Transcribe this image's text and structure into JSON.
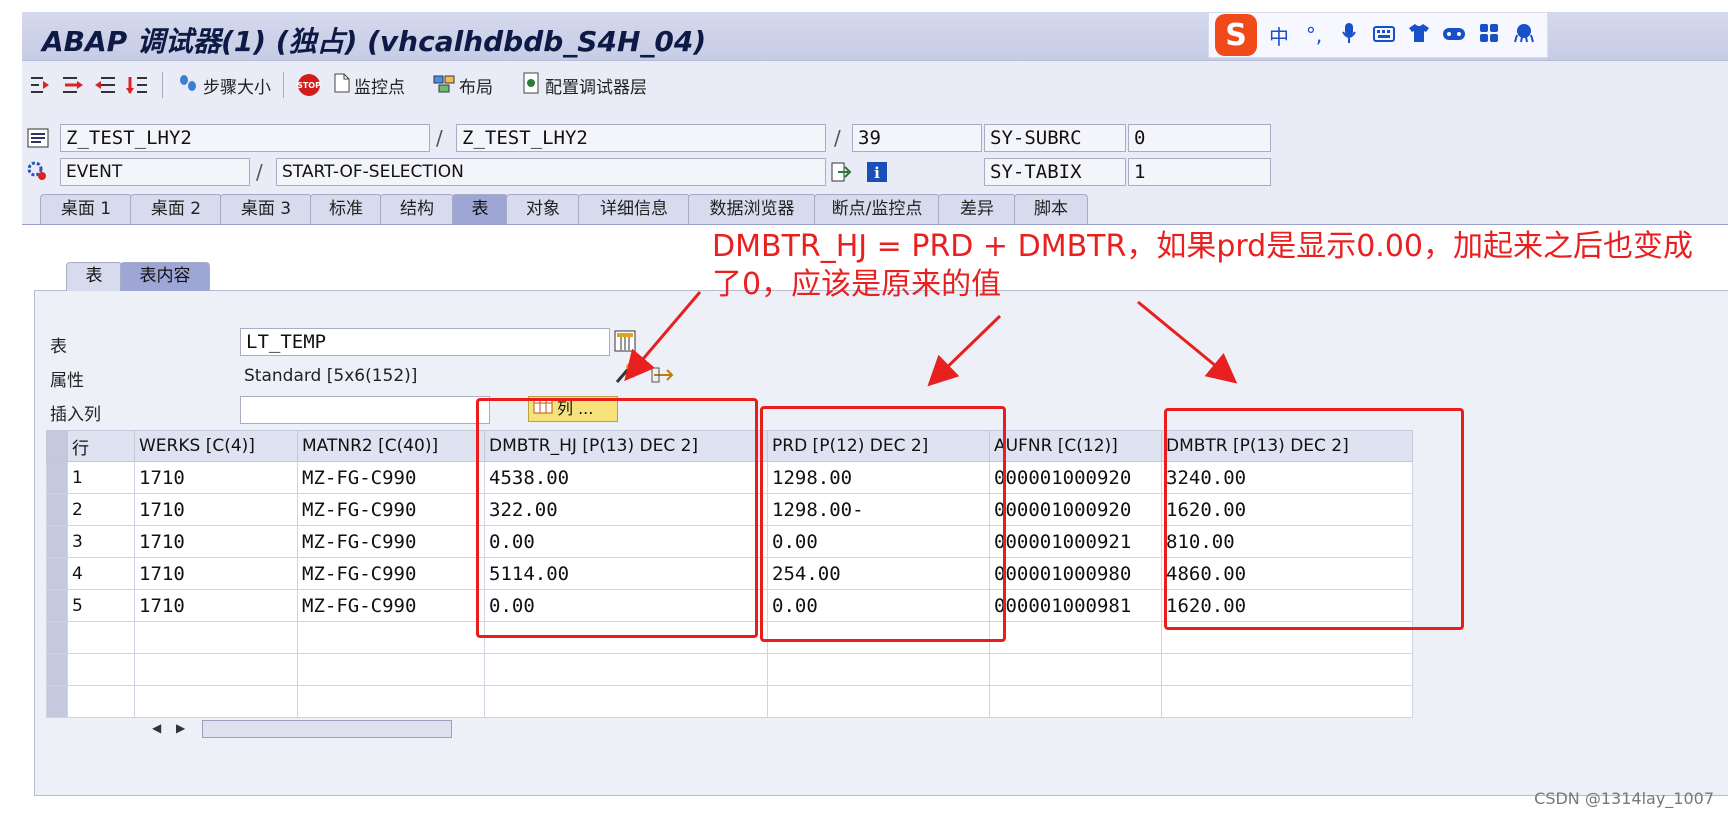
{
  "window": {
    "title": "ABAP 调试器(1)  (独占) (vhcalhdbdb_S4H_04)"
  },
  "ime": {
    "logo": "S",
    "items": [
      "中",
      "°,",
      "mic-icon",
      "keyboard-icon",
      "shirt-icon",
      "gamepad-icon",
      "apps-icon",
      "octopus-icon"
    ]
  },
  "toolbar": {
    "step_size": "步骤大小",
    "stop": "STOP",
    "watchpoint": "监控点",
    "layout": "布局",
    "config_layer": "配置调试器层"
  },
  "context": {
    "program1": "Z_TEST_LHY2",
    "program2": "Z_TEST_LHY2",
    "line": "39",
    "event_type": "EVENT",
    "event_name": "START-OF-SELECTION",
    "sy_subrc_label": "SY-SUBRC",
    "sy_subrc_value": "0",
    "sy_tabix_label": "SY-TABIX",
    "sy_tabix_value": "1"
  },
  "tabs": [
    "桌面 1",
    "桌面 2",
    "桌面 3",
    "标准",
    "结构",
    "表",
    "对象",
    "详细信息",
    "数据浏览器",
    "断点/监控点",
    "差异",
    "脚本"
  ],
  "active_tab": "表",
  "subtabs": [
    "表",
    "表内容"
  ],
  "form": {
    "table_label": "表",
    "table_value": "LT_TEMP",
    "attr_label": "属性",
    "attr_value": "Standard [5x6(152)]",
    "insert_label": "插入列",
    "insert_value": "",
    "col_button": "列 ..."
  },
  "grid": {
    "columns": [
      "行",
      "WERKS [C(4)]",
      "MATNR2 [C(40)]",
      "DMBTR_HJ [P(13) DEC 2]",
      "PRD [P(12) DEC 2]",
      "AUFNR [C(12)]",
      "DMBTR [P(13) DEC 2]"
    ],
    "rows": [
      [
        "1",
        "1710",
        "MZ-FG-C990",
        "4538.00",
        "1298.00",
        "000001000920",
        "3240.00"
      ],
      [
        "2",
        "1710",
        "MZ-FG-C990",
        "322.00",
        "1298.00-",
        "000001000920",
        "1620.00"
      ],
      [
        "3",
        "1710",
        "MZ-FG-C990",
        "0.00",
        "0.00",
        "000001000921",
        "810.00"
      ],
      [
        "4",
        "1710",
        "MZ-FG-C990",
        "5114.00",
        "254.00",
        "000001000980",
        "4860.00"
      ],
      [
        "5",
        "1710",
        "MZ-FG-C990",
        "0.00",
        "0.00",
        "000001000981",
        "1620.00"
      ],
      [
        "",
        "",
        "",
        "",
        "",
        "",
        ""
      ],
      [
        "",
        "",
        "",
        "",
        "",
        "",
        ""
      ],
      [
        "",
        "",
        "",
        "",
        "",
        "",
        ""
      ]
    ]
  },
  "annotation": {
    "text": "DMBTR_HJ = PRD + DMBTR，如果prd是显示0.00，加起来之后也变成了0，应该是原来的值",
    "color": "#e8201f"
  },
  "watermark": "CSDN @1314lay_1007"
}
